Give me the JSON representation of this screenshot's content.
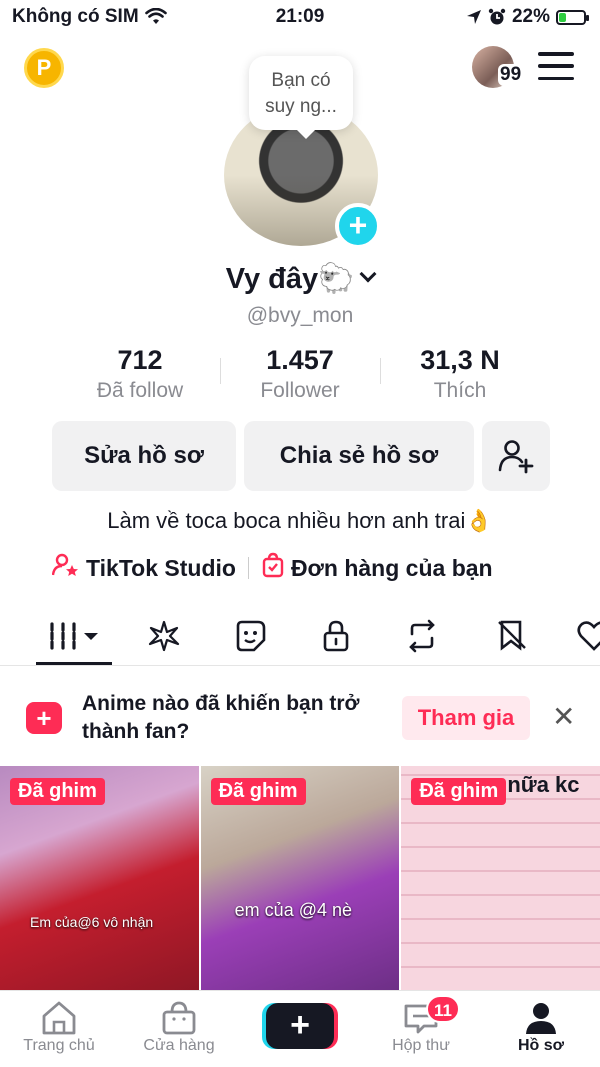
{
  "status_bar": {
    "carrier": "Không có SIM",
    "time": "21:09",
    "battery_percent": "22%"
  },
  "top": {
    "coin_label": "P",
    "notification_count": "99"
  },
  "profile": {
    "bubble_text_line1": "Bạn có",
    "bubble_text_line2": "suy ng...",
    "name": "Vy đây🐑",
    "handle": "@bvy_mon"
  },
  "stats": [
    {
      "value": "712",
      "label": "Đã follow"
    },
    {
      "value": "1.457",
      "label": "Follower"
    },
    {
      "value": "31,3 N",
      "label": "Thích"
    }
  ],
  "actions": {
    "edit_profile": "Sửa hồ sơ",
    "share_profile": "Chia sẻ hồ sơ"
  },
  "bio": "Làm về toca boca nhiều hơn anh trai👌",
  "links": {
    "studio": "TikTok Studio",
    "orders": "Đơn hàng của bạn"
  },
  "banner": {
    "text_line1": "Anime nào đã khiến bạn trở",
    "text_line2": "thành fan?",
    "join_label": "Tham gia"
  },
  "videos": [
    {
      "pin_label": "Đã ghim",
      "caption": "Em của@6 vô nhận"
    },
    {
      "pin_label": "Đã ghim",
      "caption": "em của @4 nè"
    },
    {
      "pin_label": "Đã ghim",
      "caption": "nữa kc"
    }
  ],
  "nav": {
    "home": "Trang chủ",
    "shop": "Cửa hàng",
    "inbox": "Hộp thư",
    "inbox_badge": "11",
    "profile": "Hồ sơ"
  }
}
